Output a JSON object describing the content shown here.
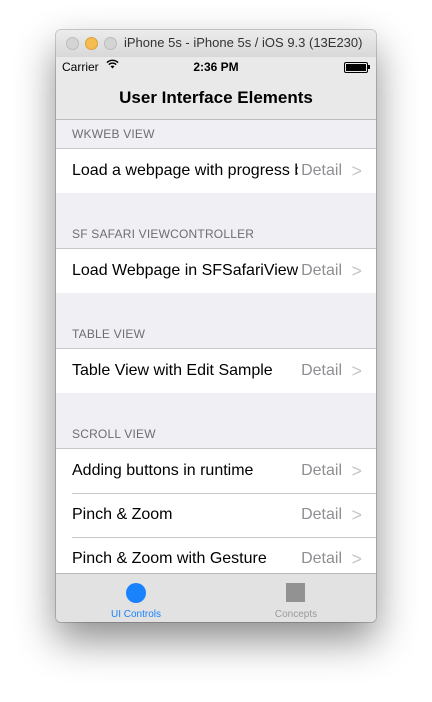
{
  "window": {
    "title": "iPhone 5s - iPhone 5s / iOS 9.3 (13E230)"
  },
  "status_bar": {
    "carrier": "Carrier",
    "time": "2:36 PM",
    "wifi_icon": "wifi-icon",
    "battery_icon": "battery-icon"
  },
  "nav": {
    "title": "User Interface Elements"
  },
  "sections": [
    {
      "header": "WKWEB VIEW",
      "rows": [
        {
          "label": "Load a webpage with progress bar",
          "detail": "Detail"
        }
      ]
    },
    {
      "header": "SF SAFARI VIEWCONTROLLER",
      "rows": [
        {
          "label": "Load Webpage in SFSafariViewController",
          "detail": "Detail"
        }
      ]
    },
    {
      "header": "TABLE VIEW",
      "rows": [
        {
          "label": "Table View with Edit Sample",
          "detail": "Detail"
        }
      ]
    },
    {
      "header": "SCROLL VIEW",
      "rows": [
        {
          "label": "Adding buttons in runtime",
          "detail": "Detail"
        },
        {
          "label": "Pinch & Zoom",
          "detail": "Detail"
        },
        {
          "label": "Pinch & Zoom with Gesture",
          "detail": "Detail"
        }
      ]
    }
  ],
  "chevron": ">",
  "tabs": [
    {
      "label": "UI Controls",
      "icon": "circle-icon",
      "selected": true
    },
    {
      "label": "Concepts",
      "icon": "square-icon",
      "selected": false
    }
  ],
  "colors": {
    "accent": "#1a82fb",
    "detail": "#8e8e93",
    "section_header": "#6d6d72"
  }
}
